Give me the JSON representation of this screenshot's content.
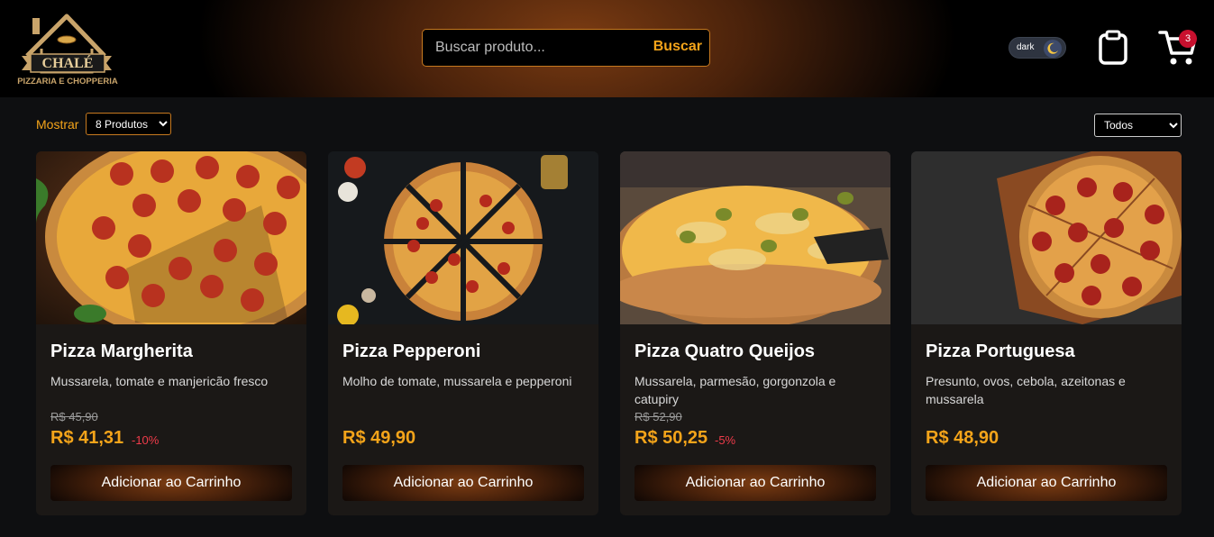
{
  "header": {
    "logo": {
      "name": "CHALÉ",
      "subtitle": "PIZZARIA E CHOPPERIA"
    },
    "search": {
      "placeholder": "Buscar produto...",
      "button_label": "Buscar"
    },
    "theme_toggle": {
      "label": "dark"
    },
    "cart": {
      "count": "3"
    }
  },
  "controls": {
    "show_label": "Mostrar",
    "show_selected": "8 Produtos",
    "filter_selected": "Todos"
  },
  "products": [
    {
      "name": "Pizza Margherita",
      "description": "Mussarela, tomate e manjericão fresco",
      "old_price": "R$ 45,90",
      "price": "R$ 41,31",
      "discount": "-10%",
      "button_label": "Adicionar ao Carrinho"
    },
    {
      "name": "Pizza Pepperoni",
      "description": "Molho de tomate, mussarela e pepperoni",
      "old_price": "",
      "price": "R$ 49,90",
      "discount": "",
      "button_label": "Adicionar ao Carrinho"
    },
    {
      "name": "Pizza Quatro Queijos",
      "description": "Mussarela, parmesão, gorgonzola e catupiry",
      "old_price": "R$ 52,90",
      "price": "R$ 50,25",
      "discount": "-5%",
      "button_label": "Adicionar ao Carrinho"
    },
    {
      "name": "Pizza Portuguesa",
      "description": "Presunto, ovos, cebola, azeitonas e mussarela",
      "old_price": "",
      "price": "R$ 48,90",
      "discount": "",
      "button_label": "Adicionar ao Carrinho"
    }
  ],
  "colors": {
    "accent": "#f4a41a",
    "discount": "#ef3b4a",
    "card_bg": "#1b1816",
    "page_bg": "#0e0f11",
    "badge": "#c8102e"
  }
}
